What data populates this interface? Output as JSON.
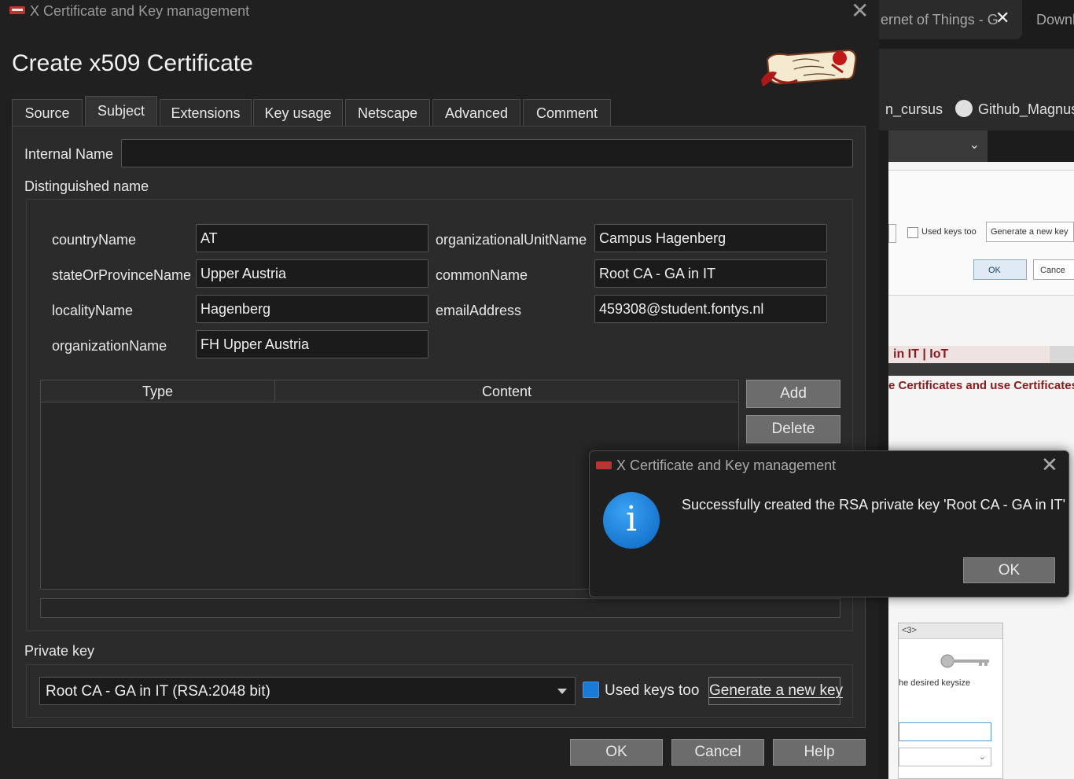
{
  "main_window": {
    "title": "X Certificate and Key management",
    "heading": "Create x509 Certificate"
  },
  "tabs": [
    {
      "label": "Source"
    },
    {
      "label": "Subject"
    },
    {
      "label": "Extensions"
    },
    {
      "label": "Key usage"
    },
    {
      "label": "Netscape"
    },
    {
      "label": "Advanced"
    },
    {
      "label": "Comment"
    }
  ],
  "active_tab": "Subject",
  "subject": {
    "internal_name_label": "Internal Name",
    "internal_name_value": "",
    "dn_label": "Distinguished name",
    "fields": {
      "countryName": {
        "label": "countryName",
        "value": "AT"
      },
      "stateOrProvinceName": {
        "label": "stateOrProvinceName",
        "value": "Upper Austria"
      },
      "localityName": {
        "label": "localityName",
        "value": "Hagenberg"
      },
      "organizationName": {
        "label": "organizationName",
        "value": "FH Upper Austria"
      },
      "organizationalUnitName": {
        "label": "organizationalUnitName",
        "value": "Campus Hagenberg"
      },
      "commonName": {
        "label": "commonName",
        "value": "Root CA - GA in IT"
      },
      "emailAddress": {
        "label": "emailAddress",
        "value": "459308@student.fontys.nl"
      }
    },
    "table": {
      "col_type": "Type",
      "col_content": "Content",
      "rows": []
    },
    "add_button": "Add",
    "delete_button": "Delete",
    "private_key_label": "Private key",
    "private_key_value": "Root CA - GA in IT (RSA:2048 bit)",
    "used_keys_label": "Used keys too",
    "used_keys_checked": true,
    "generate_key_button": "Generate a new key"
  },
  "footer": {
    "ok": "OK",
    "cancel": "Cancel",
    "help": "Help"
  },
  "dialog": {
    "title": "X Certificate and Key management",
    "message": "Successfully created the RSA private key 'Root CA - GA in IT'",
    "ok": "OK",
    "icon": "info-icon"
  },
  "background_browser": {
    "tab1": "ernet of Things - G",
    "tab2": "Downl",
    "bookmark1": "n_cursus",
    "bookmark2": "Github_Magnus",
    "shot_used_keys": "Used keys too",
    "shot_generate": "Generate a new key",
    "shot_ok": "OK",
    "shot_cancel": "Cance",
    "breadcrumb": "in IT | IoT",
    "page_link": "e Certificates and use Certificates",
    "subwin_bar": "<3>",
    "subwin_keysize": "he desired keysize"
  },
  "colors": {
    "background": "#202020",
    "panel": "#2b2b2b",
    "field": "#1b1b1b",
    "accent": "#1a7ad8"
  }
}
